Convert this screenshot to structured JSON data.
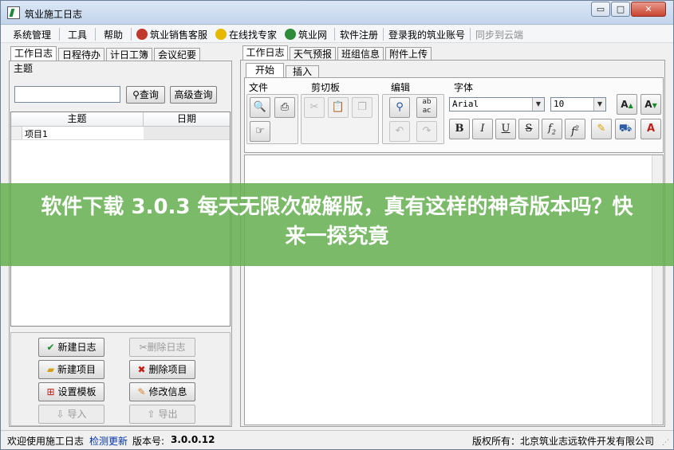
{
  "window": {
    "title": "筑业施工日志",
    "controls": {
      "minimize": "▭",
      "maximize": "□",
      "close": "✕"
    }
  },
  "menu": {
    "items": [
      "系统管理",
      "工具",
      "帮助",
      "筑业销售客服",
      "在线找专家",
      "筑业网",
      "软件注册",
      "登录我的筑业账号",
      "同步到云端"
    ]
  },
  "left": {
    "tabs": [
      "工作日志",
      "日程待办",
      "计日工簿",
      "会议纪要"
    ],
    "group_label": "主题",
    "search_value": "",
    "search_button": "查询",
    "advanced_button": "高级查询",
    "columns": [
      "主题",
      "日期"
    ],
    "rows": [
      {
        "subject": "项目1",
        "date": ""
      }
    ],
    "buttons": {
      "new_log": "新建日志",
      "delete_log": "删除日志",
      "new_project": "新建项目",
      "delete_project": "删除项目",
      "template": "设置模板",
      "edit_info": "修改信息",
      "import": "导入",
      "export": "导出"
    }
  },
  "right": {
    "tabs": [
      "工作日志",
      "天气预报",
      "班组信息",
      "附件上传"
    ],
    "ribbon_tabs": [
      "开始",
      "插入"
    ],
    "groups": {
      "file": "文件",
      "clipboard": "剪切板",
      "edit": "编辑",
      "font": "字体"
    },
    "font_name": "Arial",
    "font_size": "10"
  },
  "status": {
    "welcome": "欢迎使用施工日志",
    "update_link": "检测更新",
    "version_label": "版本号:",
    "version": "3.0.0.12",
    "copyright": "版权所有：北京筑业志远软件开发有限公司"
  },
  "banner": {
    "text": "软件下载 3.0.3 每天无限次破解版，真有这样的神奇版本吗？快来一探究竟"
  },
  "colors": {
    "banner": "#64af50",
    "title_gradient": "#c3d5ec",
    "link": "#0033aa"
  }
}
